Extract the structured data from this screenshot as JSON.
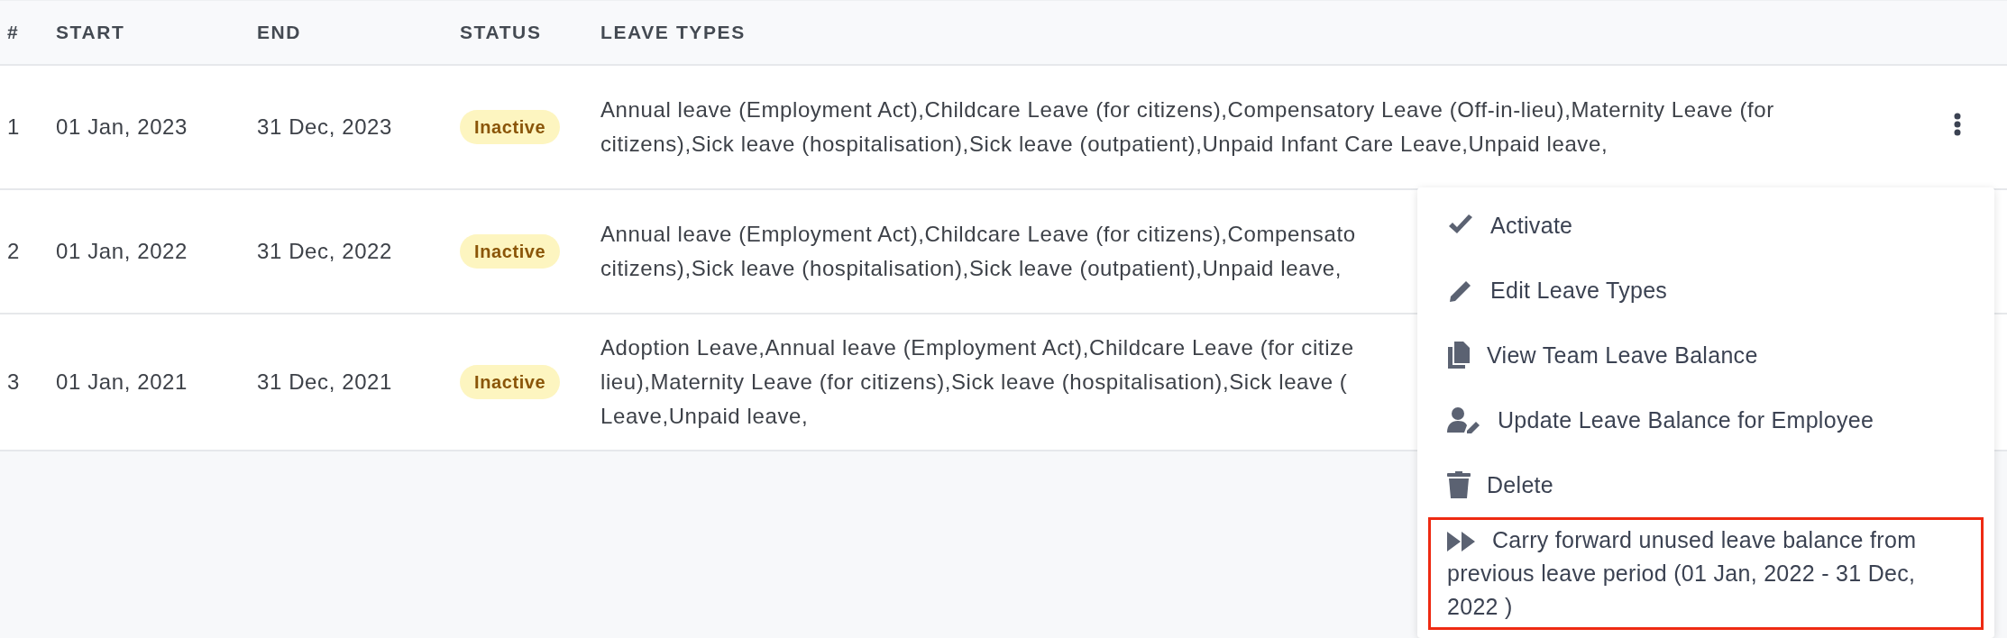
{
  "table": {
    "columns": [
      "#",
      "START",
      "END",
      "STATUS",
      "LEAVE TYPES"
    ],
    "rows": [
      {
        "number": "1",
        "start": "01 Jan, 2023",
        "end": "31 Dec, 2023",
        "status": "Inactive",
        "leave_types": [
          "Annual leave (Employment Act),Childcare Leave (for citizens),Compensatory Leave (Off-in-lieu),Maternity Leave (for",
          "citizens),Sick leave (hospitalisation),Sick leave (outpatient),Unpaid Infant Care Leave,Unpaid leave,"
        ],
        "menu_open": true
      },
      {
        "number": "2",
        "start": "01 Jan, 2022",
        "end": "31 Dec, 2022",
        "status": "Inactive",
        "leave_types": [
          "Annual leave (Employment Act),Childcare Leave (for citizens),Compensato",
          "citizens),Sick leave (hospitalisation),Sick leave (outpatient),Unpaid leave,"
        ],
        "menu_open": false
      },
      {
        "number": "3",
        "start": "01 Jan, 2021",
        "end": "31 Dec, 2021",
        "status": "Inactive",
        "leave_types": [
          "Adoption Leave,Annual leave (Employment Act),Childcare Leave (for citize",
          "lieu),Maternity Leave (for citizens),Sick leave (hospitalisation),Sick leave (",
          "Leave,Unpaid leave,"
        ],
        "menu_open": false
      }
    ]
  },
  "menu": {
    "items": [
      {
        "label": "Activate",
        "highlighted": false
      },
      {
        "label": "Edit Leave Types",
        "highlighted": false
      },
      {
        "label": "View Team Leave Balance",
        "highlighted": false
      },
      {
        "label": "Update Leave Balance for Employee",
        "highlighted": false
      },
      {
        "label": "Delete",
        "highlighted": false
      },
      {
        "label": "Carry forward unused leave balance from previous leave period (01 Jan, 2022 - 31 Dec, 2022 )",
        "highlighted": true
      }
    ]
  }
}
